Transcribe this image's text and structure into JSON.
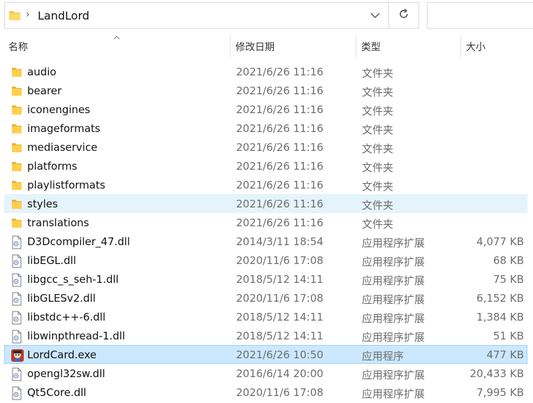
{
  "address": {
    "path": "LandLord"
  },
  "columns": {
    "name": "名称",
    "date": "修改日期",
    "type": "类型",
    "size": "大小"
  },
  "files": [
    {
      "name": "audio",
      "date": "2021/6/26 11:16",
      "type": "文件夹",
      "size": "",
      "icon": "folder-icon"
    },
    {
      "name": "bearer",
      "date": "2021/6/26 11:16",
      "type": "文件夹",
      "size": "",
      "icon": "folder-icon"
    },
    {
      "name": "iconengines",
      "date": "2021/6/26 11:16",
      "type": "文件夹",
      "size": "",
      "icon": "folder-icon"
    },
    {
      "name": "imageformats",
      "date": "2021/6/26 11:16",
      "type": "文件夹",
      "size": "",
      "icon": "folder-icon"
    },
    {
      "name": "mediaservice",
      "date": "2021/6/26 11:16",
      "type": "文件夹",
      "size": "",
      "icon": "folder-icon"
    },
    {
      "name": "platforms",
      "date": "2021/6/26 11:16",
      "type": "文件夹",
      "size": "",
      "icon": "folder-icon"
    },
    {
      "name": "playlistformats",
      "date": "2021/6/26 11:16",
      "type": "文件夹",
      "size": "",
      "icon": "folder-icon"
    },
    {
      "name": "styles",
      "date": "2021/6/26 11:16",
      "type": "文件夹",
      "size": "",
      "icon": "folder-icon",
      "state": "hover"
    },
    {
      "name": "translations",
      "date": "2021/6/26 11:16",
      "type": "文件夹",
      "size": "",
      "icon": "folder-icon"
    },
    {
      "name": "D3Dcompiler_47.dll",
      "date": "2014/3/11 18:54",
      "type": "应用程序扩展",
      "size": "4,077 KB",
      "icon": "dll-file-icon"
    },
    {
      "name": "libEGL.dll",
      "date": "2020/11/6 17:08",
      "type": "应用程序扩展",
      "size": "68 KB",
      "icon": "dll-file-icon"
    },
    {
      "name": "libgcc_s_seh-1.dll",
      "date": "2018/5/12 14:11",
      "type": "应用程序扩展",
      "size": "75 KB",
      "icon": "dll-file-icon"
    },
    {
      "name": "libGLESv2.dll",
      "date": "2020/11/6 17:08",
      "type": "应用程序扩展",
      "size": "6,152 KB",
      "icon": "dll-file-icon"
    },
    {
      "name": "libstdc++-6.dll",
      "date": "2018/5/12 14:11",
      "type": "应用程序扩展",
      "size": "1,384 KB",
      "icon": "dll-file-icon"
    },
    {
      "name": "libwinpthread-1.dll",
      "date": "2018/5/12 14:11",
      "type": "应用程序扩展",
      "size": "51 KB",
      "icon": "dll-file-icon"
    },
    {
      "name": "LordCard.exe",
      "date": "2021/6/26 10:50",
      "type": "应用程序",
      "size": "477 KB",
      "icon": "exe-app-icon",
      "state": "selected"
    },
    {
      "name": "opengl32sw.dll",
      "date": "2016/6/14 20:00",
      "type": "应用程序扩展",
      "size": "20,433 KB",
      "icon": "dll-file-icon"
    },
    {
      "name": "Qt5Core.dll",
      "date": "2020/11/6 17:08",
      "type": "应用程序扩展",
      "size": "7,995 KB",
      "icon": "dll-file-icon"
    }
  ],
  "colors": {
    "folder": "#f4c542",
    "hover": "#e5f3fb",
    "selected": "#cce8ff",
    "selected_border": "#99d1ff"
  }
}
